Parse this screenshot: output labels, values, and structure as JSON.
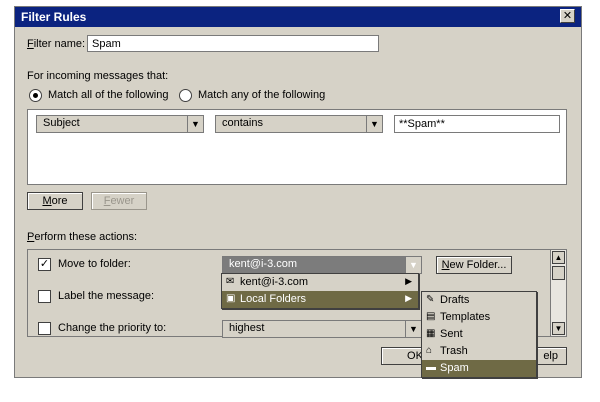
{
  "window": {
    "title": "Filter Rules",
    "close": "✕"
  },
  "filter_name": {
    "label_prefix": "F",
    "label_rest": "ilter name:",
    "value": "Spam"
  },
  "incoming": {
    "label": "For incoming messages that:"
  },
  "match": {
    "all_label": "Match all of the following",
    "any_label": "Match any of the following",
    "selected": "all"
  },
  "rule": {
    "field": "Subject",
    "operator": "contains",
    "value": "**Spam**"
  },
  "buttons": {
    "more_u": "M",
    "more_rest": "ore",
    "fewer_u": "F",
    "fewer_rest": "ewer",
    "new_folder_u": "N",
    "new_folder_rest": "ew Folder...",
    "ok": "OK",
    "help": "elp"
  },
  "actions": {
    "label_u": "P",
    "label_rest": "erform these actions:",
    "move_label": "Move to folder:",
    "move_checked": true,
    "folder_value": "kent@i-3.com",
    "label_message": "Label the message:",
    "change_priority": "Change the priority to:",
    "priority_value": "highest"
  },
  "folder_menu": [
    {
      "label": "kent@i-3.com",
      "icon": "mail-account-icon",
      "submenu": true,
      "highlighted": false
    },
    {
      "label": "Local Folders",
      "icon": "local-folders-icon",
      "submenu": true,
      "highlighted": true
    }
  ],
  "local_folders_menu": [
    {
      "label": "Drafts",
      "icon": "drafts-icon",
      "highlighted": false
    },
    {
      "label": "Templates",
      "icon": "templates-icon",
      "highlighted": false
    },
    {
      "label": "Sent",
      "icon": "sent-icon",
      "highlighted": false
    },
    {
      "label": "Trash",
      "icon": "trash-icon",
      "highlighted": false
    },
    {
      "label": "Spam",
      "icon": "folder-icon",
      "highlighted": true
    }
  ],
  "colors": {
    "titlebar": "#0b2380",
    "dialog_bg": "#d6d2c7",
    "menu_highlight": "#6f6a45"
  }
}
